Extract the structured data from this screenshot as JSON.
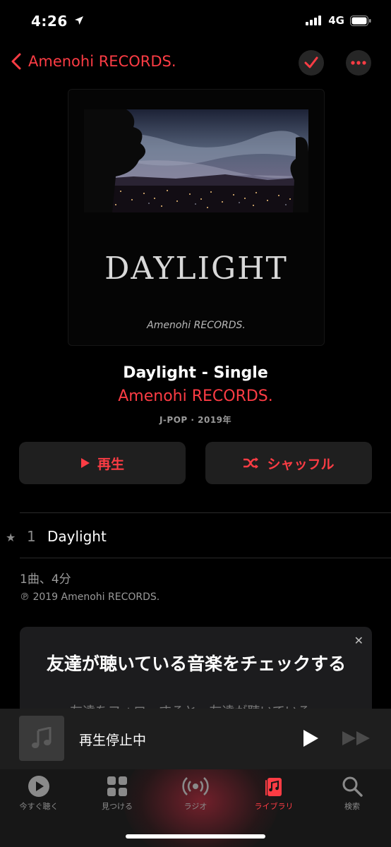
{
  "status": {
    "time": "4:26",
    "network": "4G"
  },
  "nav": {
    "back_label": "Amenohi RECORDS."
  },
  "artwork": {
    "title_text": "DAYLIGHT",
    "label_text": "Amenohi RECORDS."
  },
  "album": {
    "title": "Daylight - Single",
    "artist": "Amenohi RECORDS.",
    "meta": "J-POP · 2019年"
  },
  "actions": {
    "play_label": "再生",
    "shuffle_label": "シャッフル"
  },
  "tracks": [
    {
      "number": "1",
      "title": "Daylight"
    }
  ],
  "summary": {
    "count": "1曲、4分",
    "copyright": "℗ 2019 Amenohi RECORDS."
  },
  "friends_card": {
    "title": "友達が聴いている音楽をチェックする",
    "subtitle": "友達をフォローすると、友達が聴いている..."
  },
  "mini_player": {
    "title": "再生停止中"
  },
  "tabs": [
    {
      "label": "今すぐ聴く",
      "icon": "play-circle-icon"
    },
    {
      "label": "見つける",
      "icon": "grid-icon"
    },
    {
      "label": "ラジオ",
      "icon": "radio-icon"
    },
    {
      "label": "ライブラリ",
      "icon": "library-icon"
    },
    {
      "label": "検索",
      "icon": "search-icon"
    }
  ],
  "active_tab": "ライブラリ",
  "colors": {
    "accent": "#fc3c44",
    "background": "#000000",
    "button_bg": "#1f1f1f"
  }
}
